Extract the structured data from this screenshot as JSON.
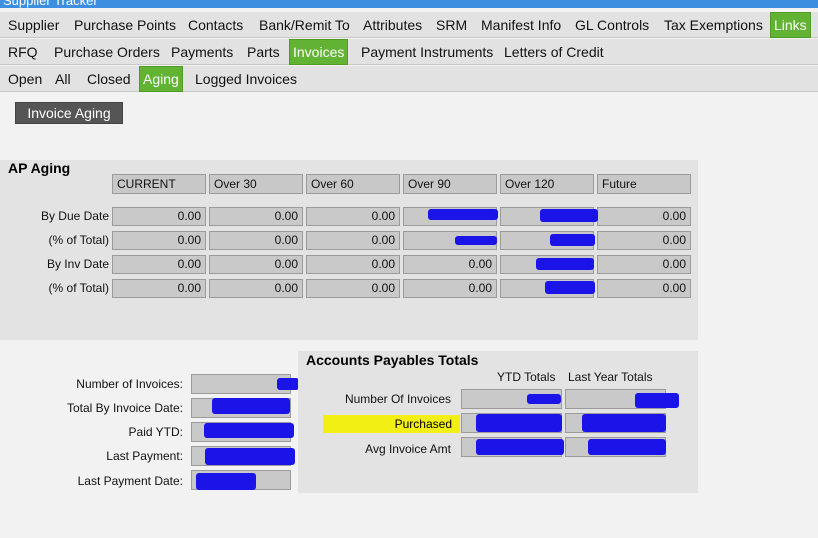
{
  "window": {
    "title": "Supplier Tracker"
  },
  "tabs_row1": [
    "Supplier",
    "Purchase Points",
    "Contacts",
    "Bank/Remit To",
    "Attributes",
    "SRM",
    "Manifest Info",
    "GL Controls",
    "Tax Exemptions",
    "Links"
  ],
  "tabs_row2": [
    "RFQ",
    "Purchase Orders",
    "Payments",
    "Parts",
    "Invoices",
    "Payment Instruments",
    "Letters of Credit"
  ],
  "tabs_row3": [
    "Open",
    "All",
    "Closed",
    "Aging",
    "Logged Invoices"
  ],
  "invoice_aging_button": "Invoice Aging",
  "ap_aging": {
    "title": "AP Aging",
    "columns": [
      "CURRENT",
      "Over 30",
      "Over 60",
      "Over 90",
      "Over 120",
      "Future"
    ],
    "rows": [
      {
        "label": "By Due Date",
        "values": [
          "0.00",
          "0.00",
          "0.00",
          "",
          "",
          "0.00"
        ]
      },
      {
        "label": "(% of Total)",
        "values": [
          "0.00",
          "0.00",
          "0.00",
          "",
          "",
          "0.00"
        ]
      },
      {
        "label": "By Inv Date",
        "values": [
          "0.00",
          "0.00",
          "0.00",
          "0.00",
          "",
          "0.00"
        ]
      },
      {
        "label": "(% of Total)",
        "values": [
          "0.00",
          "0.00",
          "0.00",
          "0.00",
          "",
          "0.00"
        ]
      }
    ]
  },
  "summary": {
    "number_of_invoices": "Number of Invoices:",
    "total_by_invoice_date": "Total By Invoice Date:",
    "paid_ytd": "Paid YTD:",
    "last_payment": "Last Payment:",
    "last_payment_date": "Last Payment Date:"
  },
  "ap_totals": {
    "title": "Accounts Payables Totals",
    "col_ytd": "YTD Totals",
    "col_last_year": "Last Year Totals",
    "row_number": "Number Of Invoices",
    "row_purchased": "Purchased",
    "row_avg": "Avg Invoice Amt"
  },
  "colors": {
    "active_tab": "#62b233",
    "redaction": "#1a14e8",
    "highlight": "#f2ef14"
  }
}
